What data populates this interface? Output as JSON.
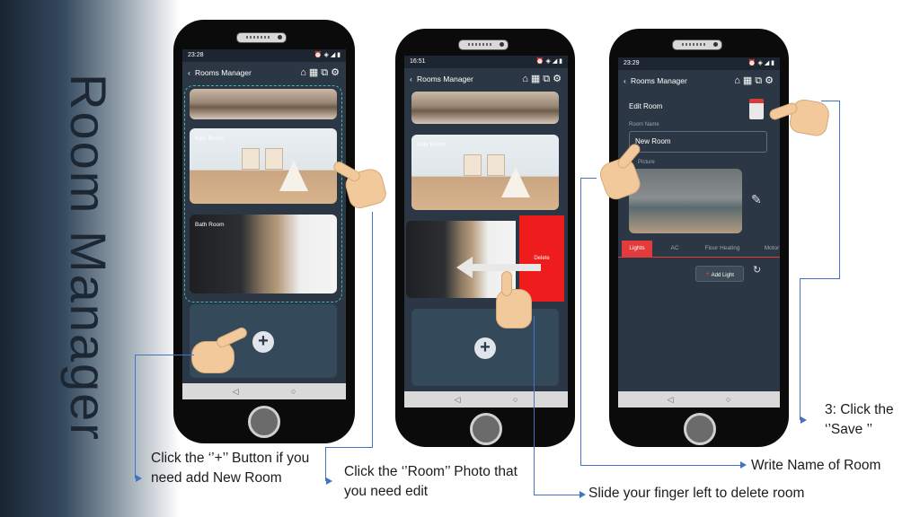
{
  "title": "Room Manager",
  "phone1": {
    "status_time": "23:28",
    "status_right": "⏰ ◈ ◢ ▮",
    "header_title": "Rooms Manager",
    "rooms": [
      {
        "label": ""
      },
      {
        "label": "Kids Room"
      },
      {
        "label": "Bath Room"
      }
    ],
    "add_symbol": "+",
    "nav": "◁ ○ □"
  },
  "phone2": {
    "status_time": "16:51",
    "status_right": "⏰ ◈ ◢ ▮",
    "header_title": "Rooms Manager",
    "rooms": [
      {
        "label": ""
      },
      {
        "label": "Kids Room"
      },
      {
        "label": ""
      }
    ],
    "delete_label": "Delete",
    "add_symbol": "+",
    "nav": "◁ ○ □"
  },
  "phone3": {
    "status_time": "23:29",
    "status_right": "⏰ ◈ ◢ ▮",
    "header_title": "Rooms Manager",
    "section_title": "Edit Room",
    "room_name_label": "Room Name",
    "room_name_value": "New Room",
    "picture_label": "Picture",
    "tabs": [
      "Lights",
      "AC",
      "Floor Heating",
      "Motor"
    ],
    "add_light_label": "Add Light",
    "nav": "◁ ○ □"
  },
  "captions": {
    "add_room": "Click the ‘’+’’ Button if you need add New Room",
    "edit_room": "Click the ‘’Room’’ Photo that you need edit",
    "delete_room": "Slide your finger left to delete room",
    "write_name": "Write Name of Room",
    "save": "3: Click the ‘’Save ’’"
  },
  "colors": {
    "app_background": "#2b3744",
    "delete_red": "#ee1c1c",
    "active_tab": "#e23b3b",
    "dashed_outline": "#3fb8a5",
    "callout_line": "#4472c4"
  }
}
